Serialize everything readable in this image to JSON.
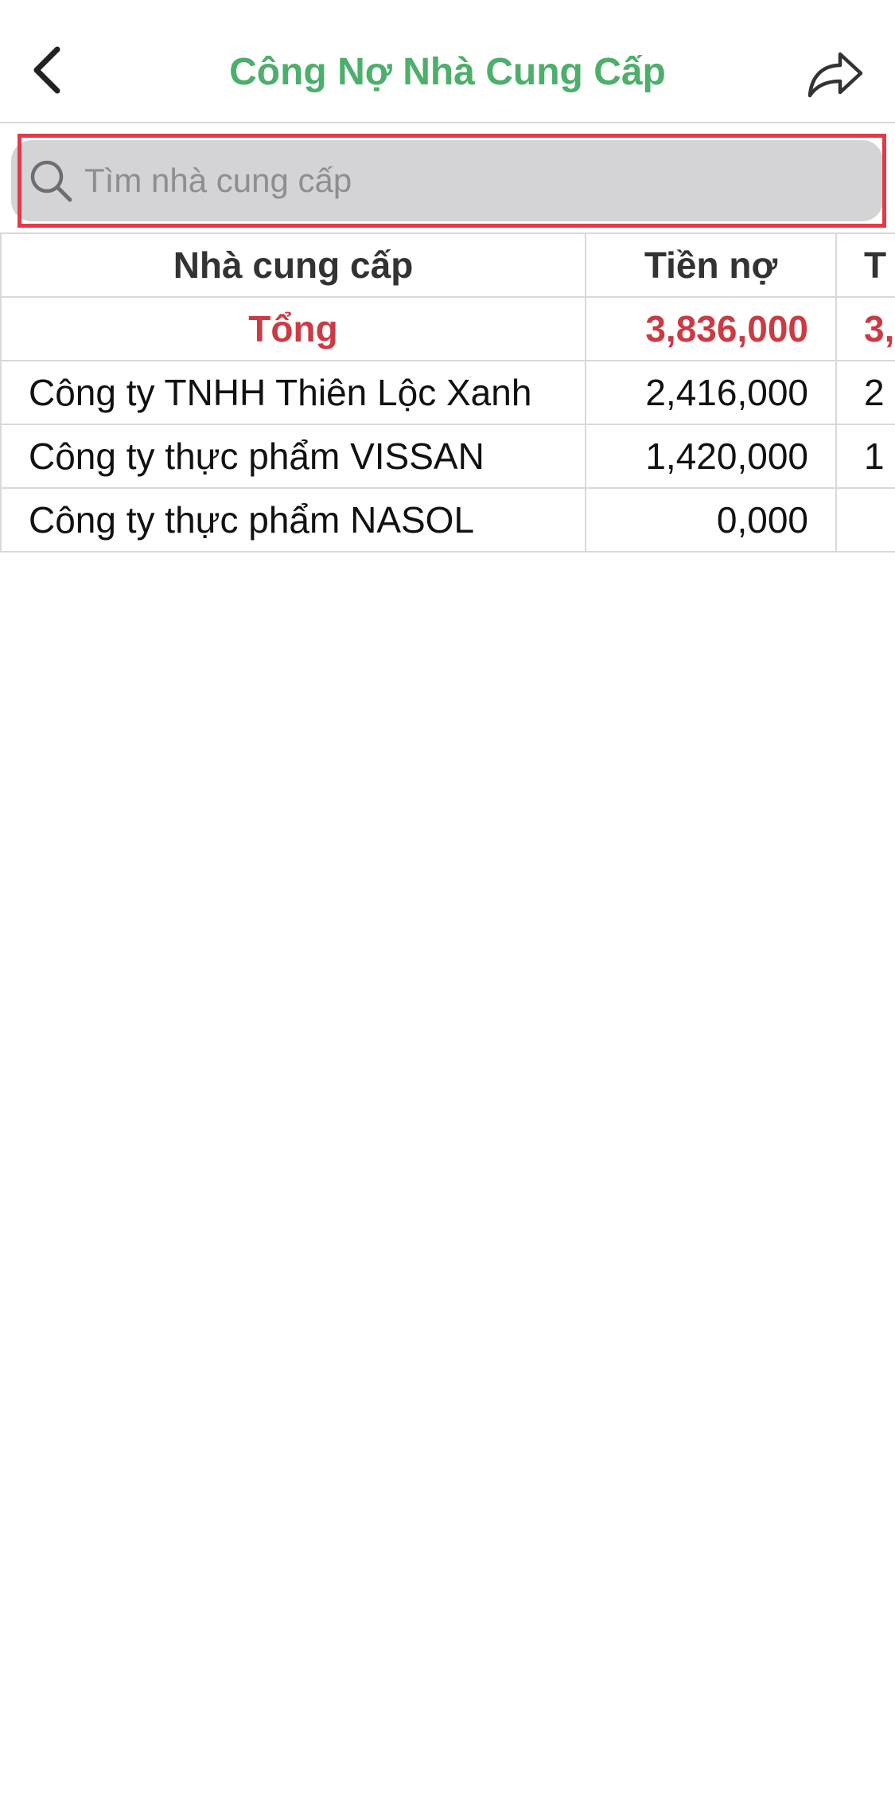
{
  "header": {
    "title": "Công Nợ Nhà Cung Cấp",
    "back_icon": "chevron-left-icon",
    "share_icon": "share-arrow-icon"
  },
  "search": {
    "placeholder": "Tìm nhà cung cấp",
    "value": "",
    "icon": "search-icon",
    "highlight_color": "#e23b46"
  },
  "table": {
    "columns": [
      "Nhà cung cấp",
      "Tiền nợ",
      "T"
    ],
    "total": {
      "label": "Tổng",
      "debt": "3,836,000",
      "extra": "3,"
    },
    "rows": [
      {
        "name": "Công ty TNHH Thiên Lộc Xanh",
        "debt": "2,416,000",
        "extra": "2"
      },
      {
        "name": "Công ty thực phẩm VISSAN",
        "debt": "1,420,000",
        "extra": "1"
      },
      {
        "name": "Công ty thực phẩm NASOL",
        "debt": "0,000",
        "extra": ""
      }
    ]
  },
  "colors": {
    "title": "#4caf6a",
    "total": "#cc3a43",
    "search_bg": "#d4d4d6",
    "grid": "#d9d9d9"
  }
}
